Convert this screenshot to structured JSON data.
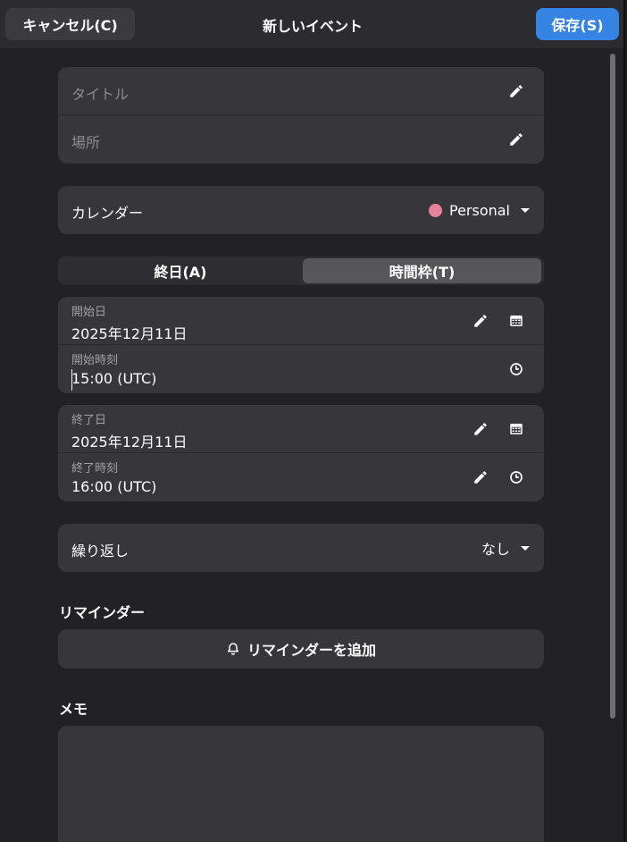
{
  "header": {
    "cancel_label": "キャンセル(C)",
    "title": "新しいイベント",
    "save_label": "保存(S)"
  },
  "details": {
    "title_placeholder": "タイトル",
    "location_placeholder": "場所"
  },
  "calendar": {
    "label": "カレンダー",
    "selected": "Personal",
    "color": "#e5839a"
  },
  "mode_toggle": {
    "all_day_label": "終日(A)",
    "time_slot_label": "時間枠(T)",
    "active": "time_slot"
  },
  "start": {
    "date_label": "開始日",
    "date_value": "2025年12月11日",
    "time_label": "開始時刻",
    "time_value": "15:00 (UTC)"
  },
  "end": {
    "date_label": "終了日",
    "date_value": "2025年12月11日",
    "time_label": "終了時刻",
    "time_value": "16:00 (UTC)"
  },
  "repeat": {
    "label": "繰り返し",
    "value": "なし"
  },
  "reminders": {
    "heading": "リマインダー",
    "add_label": "リマインダーを追加"
  },
  "memo": {
    "heading": "メモ"
  },
  "icons": {
    "edit": "pencil-icon",
    "calendar": "calendar-icon",
    "clock": "clock-icon",
    "dropdown": "chevron-down-icon",
    "bell": "bell-icon"
  },
  "colors": {
    "accent": "#3584e4",
    "card": "#36363b",
    "background": "#222226"
  }
}
